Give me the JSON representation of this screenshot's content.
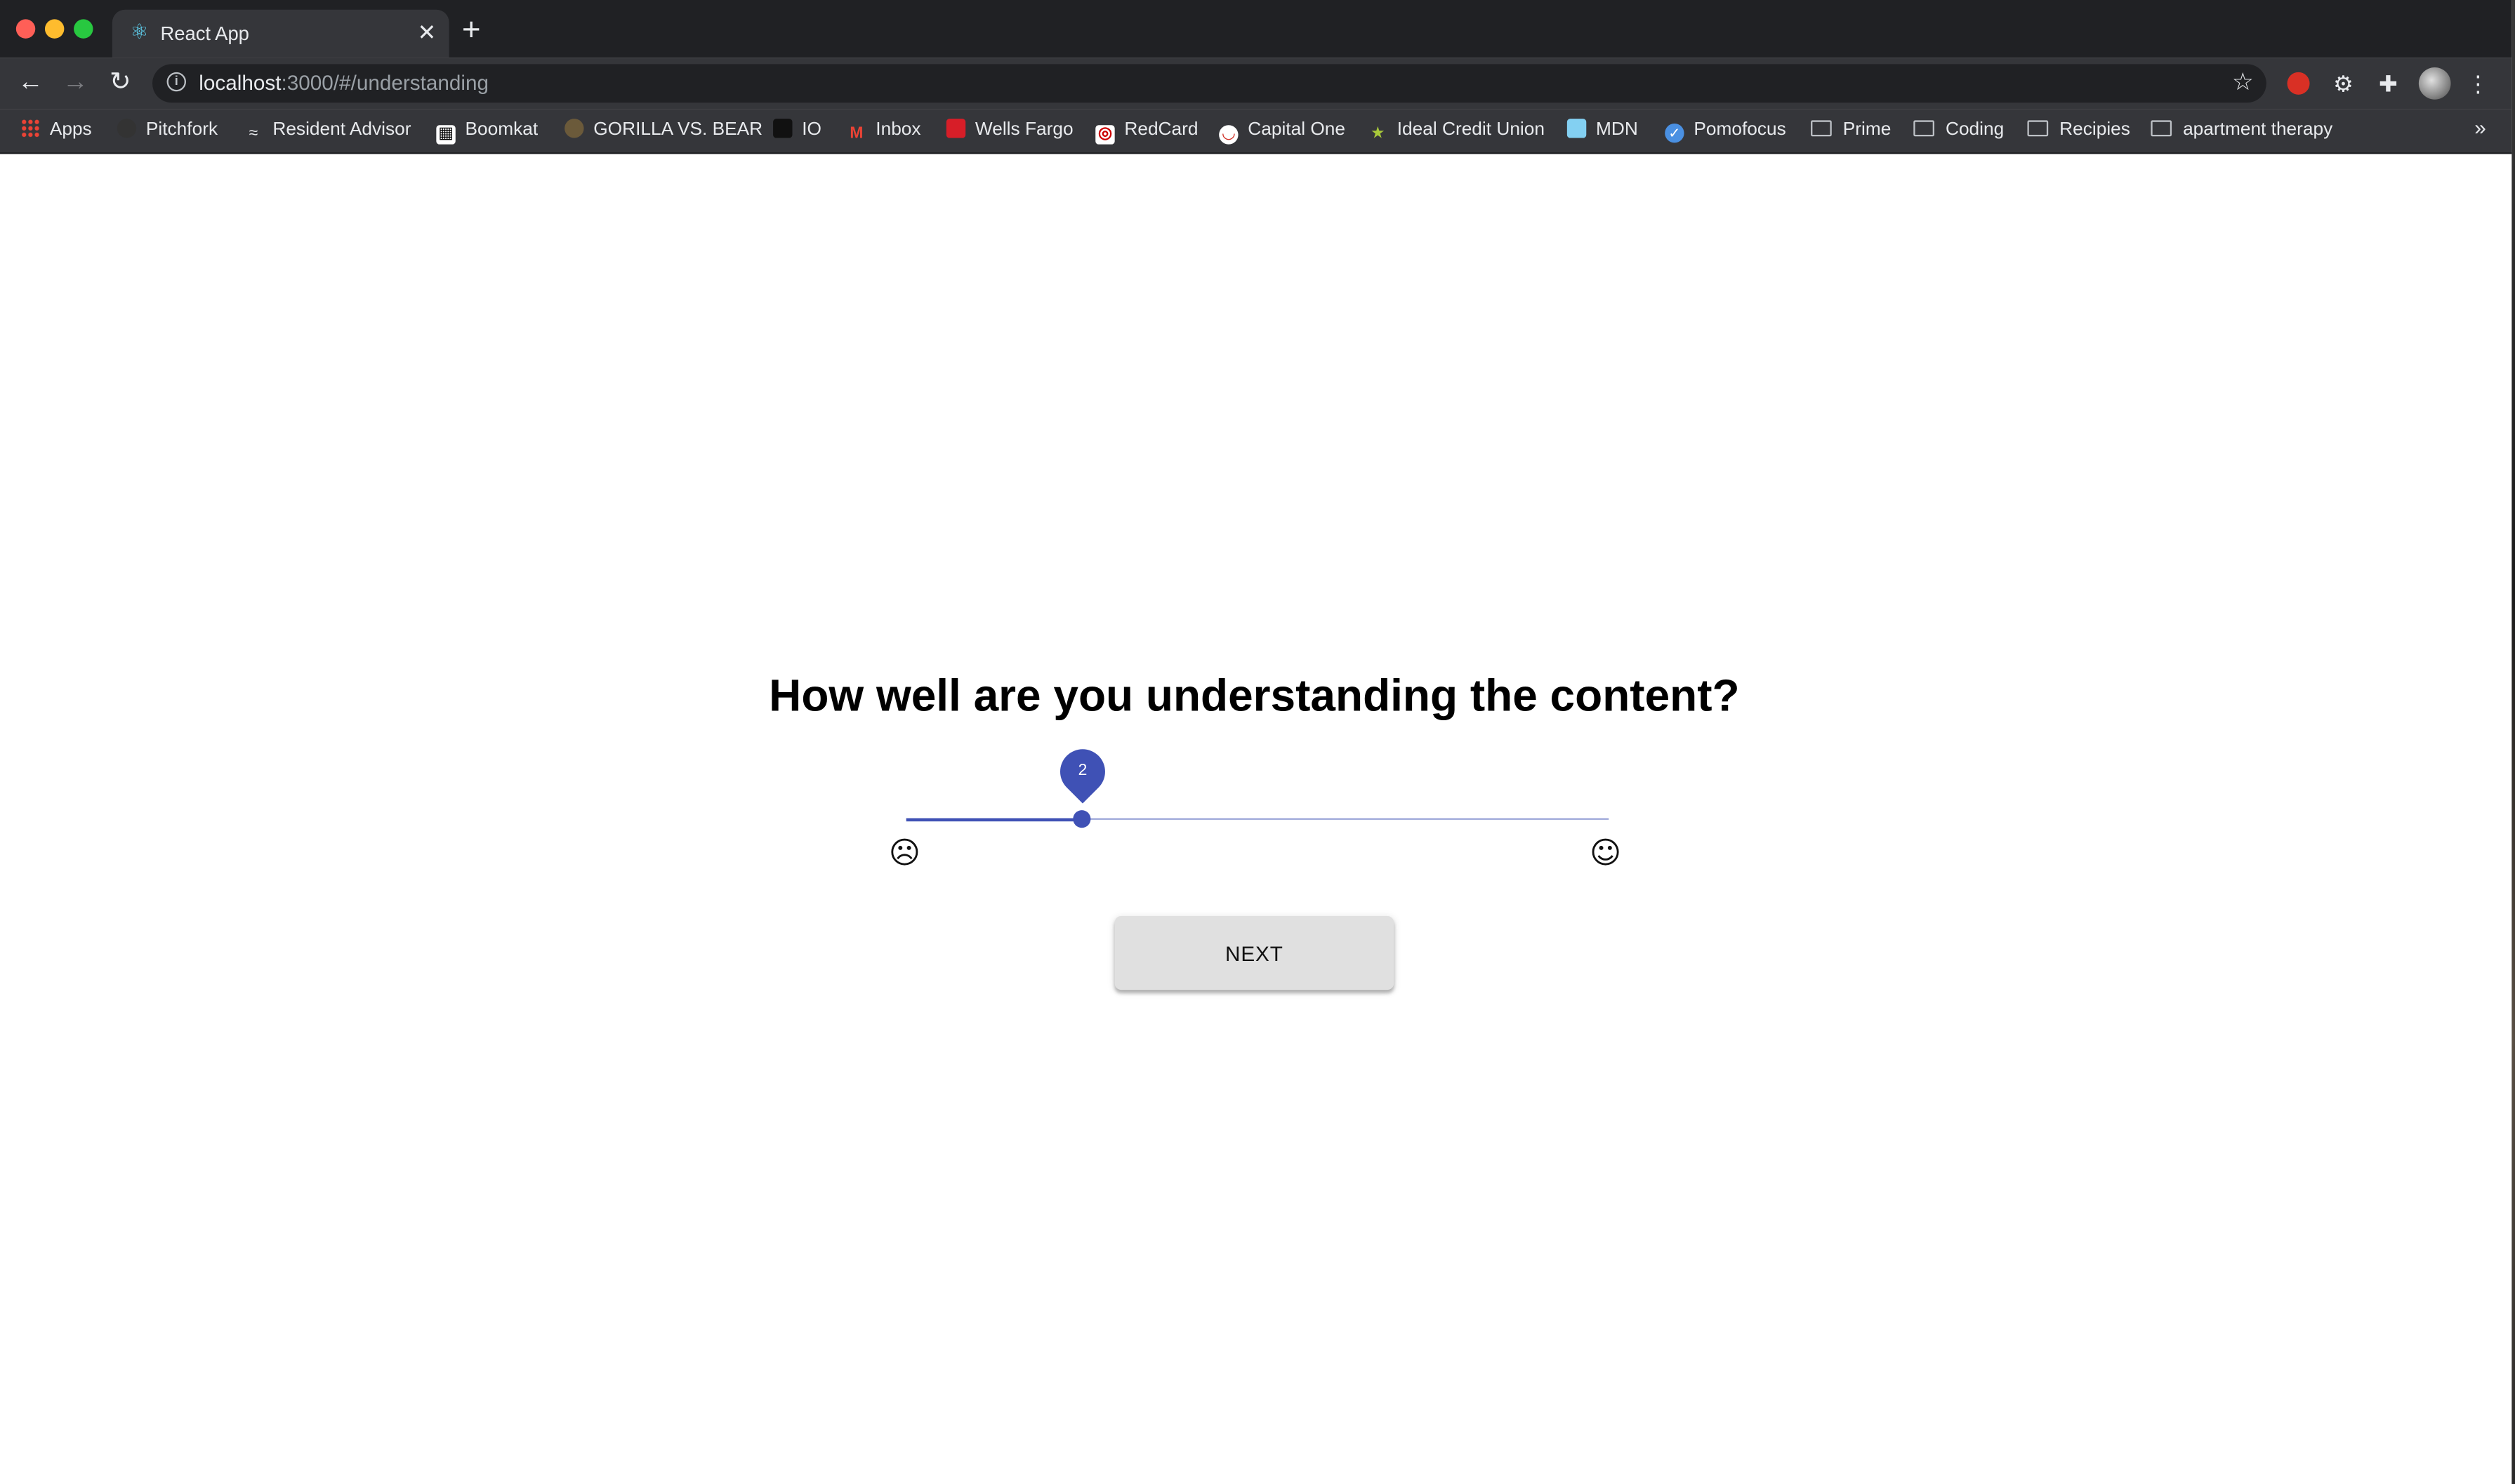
{
  "browser": {
    "tab": {
      "title": "React App",
      "favicon_icon": "react-atom-icon"
    },
    "url": {
      "host": "localhost",
      "rest": ":3000/#/understanding"
    },
    "bookmarks": [
      {
        "label": "Apps",
        "icon": "apps-grid-icon"
      },
      {
        "label": "Pitchfork",
        "icon": "pitchfork-icon"
      },
      {
        "label": "Resident Advisor",
        "icon": "resident-advisor-icon"
      },
      {
        "label": "Boomkat",
        "icon": "boomkat-icon"
      },
      {
        "label": "GORILLA VS. BEAR",
        "icon": "gorilla-vs-bear-icon"
      },
      {
        "label": "IO",
        "icon": "io-icon"
      },
      {
        "label": "Inbox",
        "icon": "gmail-icon"
      },
      {
        "label": "Wells Fargo",
        "icon": "wells-fargo-icon"
      },
      {
        "label": "RedCard",
        "icon": "target-icon"
      },
      {
        "label": "Capital One",
        "icon": "capital-one-icon"
      },
      {
        "label": "Ideal Credit Union",
        "icon": "star-icon"
      },
      {
        "label": "MDN",
        "icon": "mdn-icon"
      },
      {
        "label": "Pomofocus",
        "icon": "pomofocus-icon"
      },
      {
        "label": "Prime",
        "icon": "folder-icon"
      },
      {
        "label": "Coding",
        "icon": "folder-icon"
      },
      {
        "label": "Recipies",
        "icon": "folder-icon"
      },
      {
        "label": "apartment therapy",
        "icon": "folder-icon"
      }
    ],
    "more_bookmarks": "»"
  },
  "page": {
    "question": "How well are you understanding the content?",
    "slider": {
      "value": 2,
      "value_label": "2",
      "fraction": 0.25,
      "min_icon": "sad-face-icon",
      "max_icon": "happy-face-icon",
      "min_glyph": "☹",
      "max_glyph": "☺",
      "color": "#3f51b5"
    },
    "next_button": "NEXT"
  }
}
